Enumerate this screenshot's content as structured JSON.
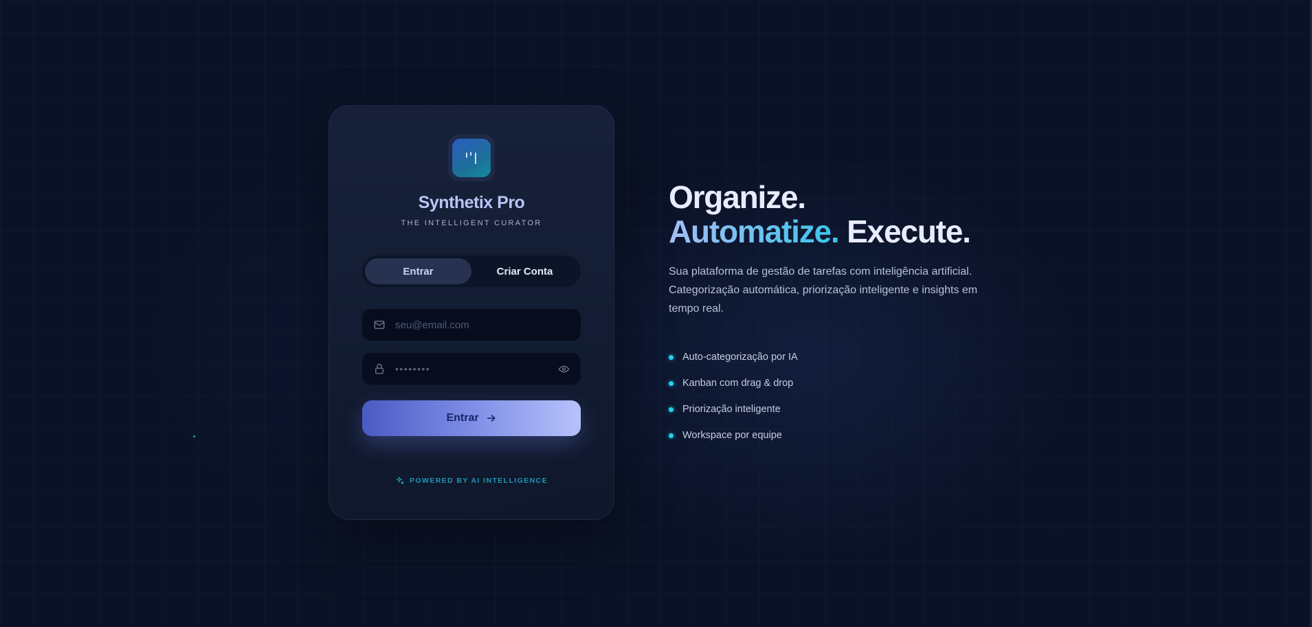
{
  "brand": {
    "name": "Synthetix Pro",
    "tagline": "THE INTELLIGENT CURATOR",
    "logo_icon": "bars-logo-icon"
  },
  "auth_tabs": {
    "login_label": "Entrar",
    "signup_label": "Criar Conta",
    "active": "login"
  },
  "form": {
    "email_placeholder": "seu@email.com",
    "email_value": "",
    "password_mask": "••••••••",
    "submit_label": "Entrar",
    "icons": {
      "email": "mail-icon",
      "password": "lock-icon",
      "toggle_visibility": "eye-icon",
      "submit": "arrow-right-icon"
    }
  },
  "footer": {
    "powered_label": "POWERED BY AI INTELLIGENCE",
    "icon": "sparkles-icon"
  },
  "hero": {
    "headline_1": "Organize.",
    "headline_2_accent": "Automatize.",
    "headline_2_rest": "Execute.",
    "description": "Sua plataforma de gestão de tarefas com inteligência artificial. Categorização automática, priorização inteligente e insights em tempo real.",
    "features": [
      "Auto-categorização por IA",
      "Kanban com drag & drop",
      "Priorização inteligente",
      "Workspace por equipe"
    ]
  },
  "colors": {
    "background": "#0a1226",
    "card": "#141e36",
    "accent_cyan": "#22d3ee",
    "accent_indigo": "#b9c4f6",
    "button_start": "#4a5ac4",
    "button_end": "#b7c2fb"
  }
}
